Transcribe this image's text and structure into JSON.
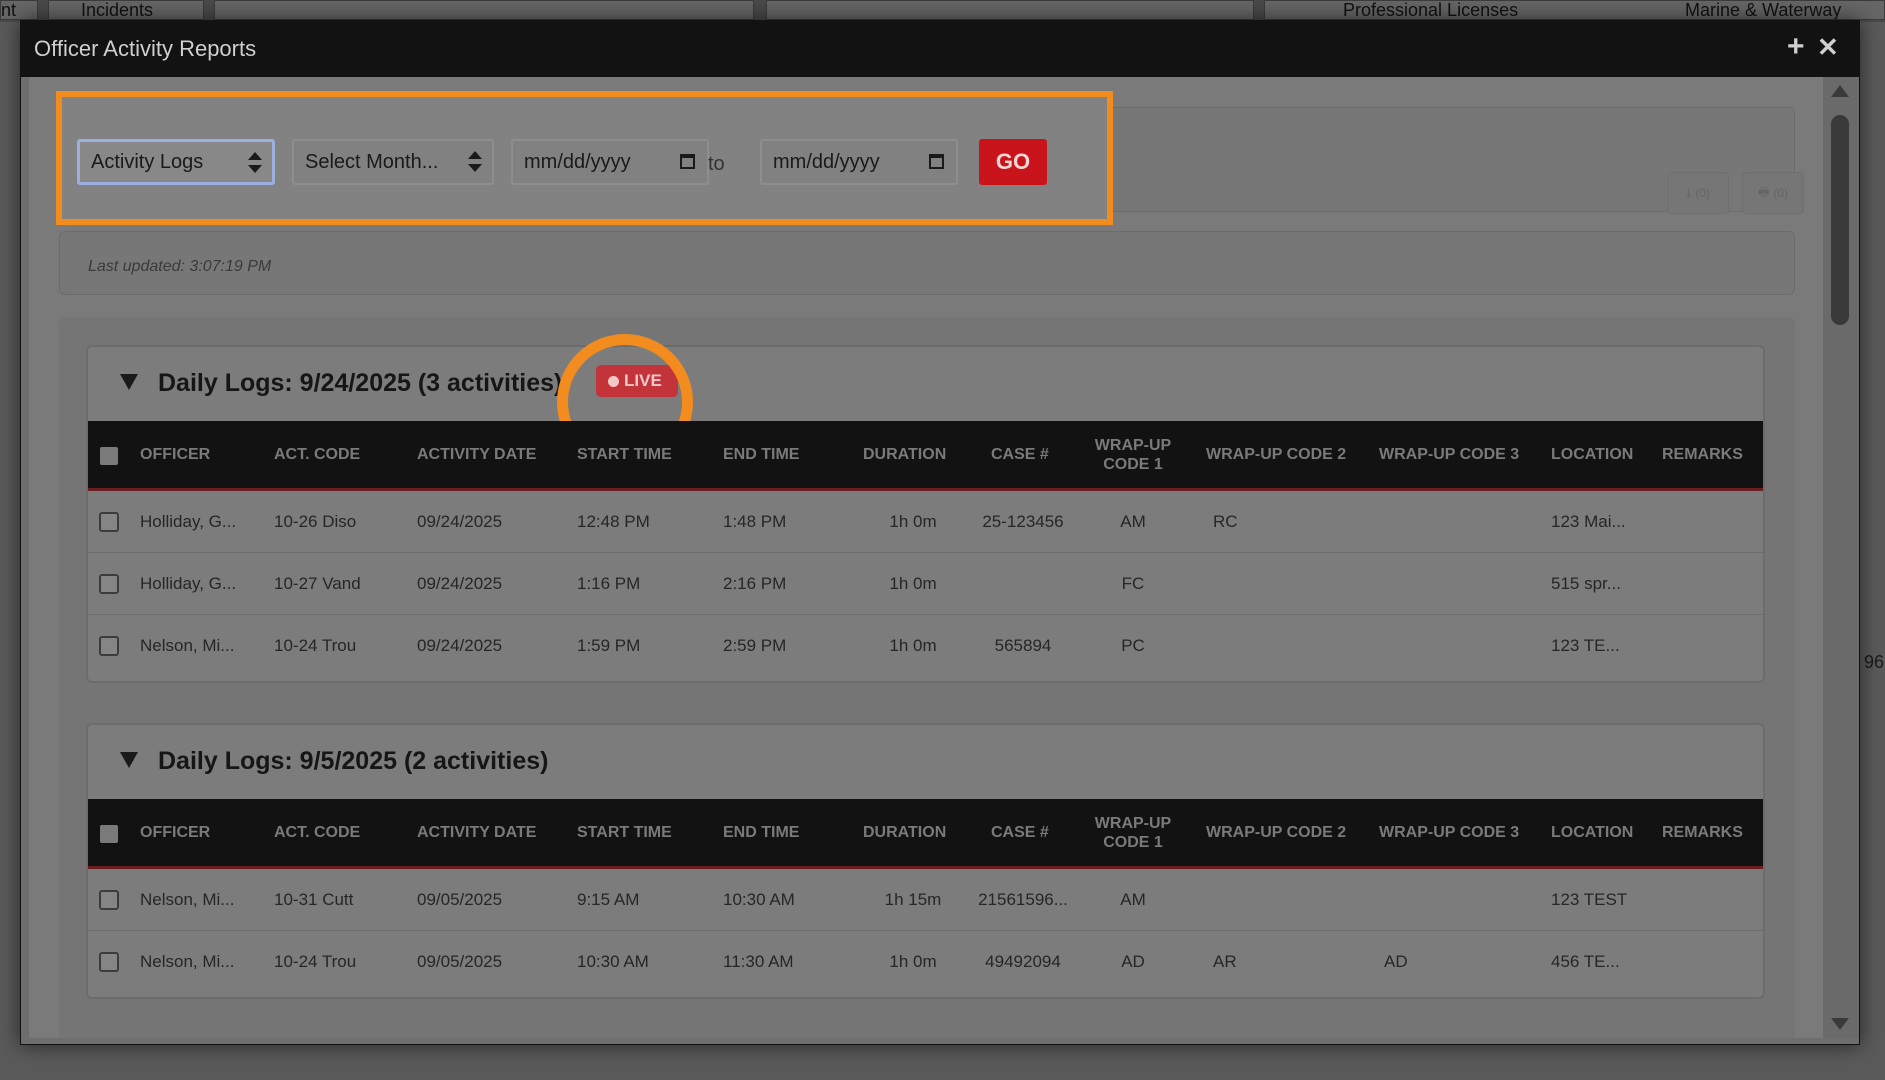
{
  "background": {
    "tabs": [
      "Incidents",
      "",
      "",
      "Professional Licenses",
      "Marine & Waterway"
    ],
    "left_fragment": "nt",
    "right_fragment": "96"
  },
  "modal": {
    "title": "Officer Activity Reports",
    "add_icon": "plus-icon",
    "close_icon": "close-icon"
  },
  "filters": {
    "report_type": "Activity Logs",
    "month_select": "Select Month...",
    "date_from_placeholder": "mm/dd/yyyy",
    "to_label": "to",
    "date_to_placeholder": "mm/dd/yyyy",
    "go_label": "GO",
    "download_count": "(0)",
    "print_count": "(0)"
  },
  "last_updated": "Last updated: 3:07:19 PM",
  "columns": [
    "OFFICER",
    "ACT. CODE",
    "ACTIVITY DATE",
    "START TIME",
    "END TIME",
    "DURATION",
    "CASE #",
    "WRAP-UP CODE 1",
    "WRAP-UP CODE 2",
    "WRAP-UP CODE 3",
    "LOCATION",
    "REMARKS"
  ],
  "groups": [
    {
      "title": "Daily Logs: 9/24/2025 (3 activities)",
      "live": "LIVE",
      "rows": [
        {
          "officer": "Holliday, G...",
          "act_code": "10-26 Diso",
          "date": "09/24/2025",
          "start": "12:48 PM",
          "end": "1:48 PM",
          "duration": "1h 0m",
          "case": "25-123456",
          "w1": "AM",
          "w2": "RC",
          "w3": "",
          "location": "123 Mai...",
          "remarks": ""
        },
        {
          "officer": "Holliday, G...",
          "act_code": "10-27 Vand",
          "date": "09/24/2025",
          "start": "1:16 PM",
          "end": "2:16 PM",
          "duration": "1h 0m",
          "case": "",
          "w1": "FC",
          "w2": "",
          "w3": "",
          "location": "515 spr...",
          "remarks": ""
        },
        {
          "officer": "Nelson, Mi...",
          "act_code": "10-24 Trou",
          "date": "09/24/2025",
          "start": "1:59 PM",
          "end": "2:59 PM",
          "duration": "1h 0m",
          "case": "565894",
          "w1": "PC",
          "w2": "",
          "w3": "",
          "location": "123 TE...",
          "remarks": ""
        }
      ]
    },
    {
      "title": "Daily Logs: 9/5/2025 (2 activities)",
      "live": "",
      "rows": [
        {
          "officer": "Nelson, Mi...",
          "act_code": "10-31 Cutt",
          "date": "09/05/2025",
          "start": "9:15 AM",
          "end": "10:30 AM",
          "duration": "1h 15m",
          "case": "21561596...",
          "w1": "AM",
          "w2": "",
          "w3": "",
          "location": "123 TEST",
          "remarks": ""
        },
        {
          "officer": "Nelson, Mi...",
          "act_code": "10-24 Trou",
          "date": "09/05/2025",
          "start": "10:30 AM",
          "end": "11:30 AM",
          "duration": "1h 0m",
          "case": "49492094",
          "w1": "AD",
          "w2": "AR",
          "w3": "AD",
          "location": "456 TE...",
          "remarks": ""
        }
      ]
    }
  ],
  "colors": {
    "highlight": "#f28c1e",
    "go_button": "#c8141a",
    "live_badge": "#c2333a",
    "table_header": "#121212"
  }
}
